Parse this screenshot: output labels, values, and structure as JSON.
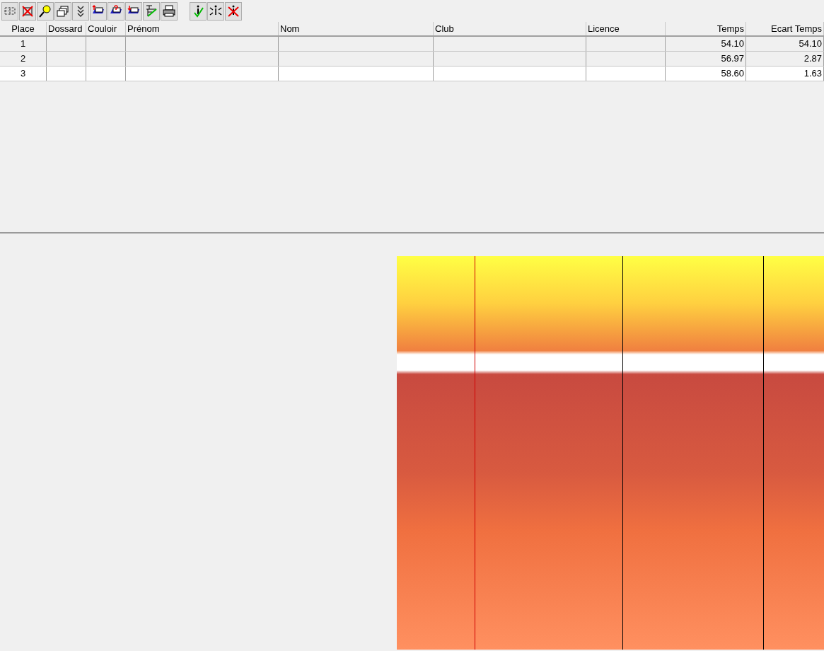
{
  "toolbar": {
    "buttons": [
      {
        "kind": "grid"
      },
      {
        "kind": "cross-grid"
      },
      {
        "kind": "magnifier"
      },
      {
        "kind": "windows"
      },
      {
        "kind": "checks"
      },
      {
        "kind": "tray-up"
      },
      {
        "kind": "tray-question"
      },
      {
        "kind": "tray-down"
      },
      {
        "kind": "chart"
      },
      {
        "kind": "printer"
      },
      {
        "kind": "person-check"
      },
      {
        "kind": "person-split"
      },
      {
        "kind": "person-cross"
      }
    ]
  },
  "table": {
    "columns": [
      "Place",
      "Dossard",
      "Couloir",
      "Prénom",
      "Nom",
      "Club",
      "Licence",
      "Temps",
      "Ecart Temps"
    ],
    "rows": [
      {
        "cells": [
          "1",
          "",
          "",
          "",
          "",
          "",
          "",
          "54.10",
          "54.10"
        ],
        "selected": false
      },
      {
        "cells": [
          "2",
          "",
          "",
          "",
          "",
          "",
          "",
          "56.97",
          "2.87"
        ],
        "selected": false
      },
      {
        "cells": [
          "3",
          "",
          "",
          "",
          "",
          "",
          "",
          "58.60",
          "1.63"
        ],
        "selected": true
      }
    ]
  }
}
